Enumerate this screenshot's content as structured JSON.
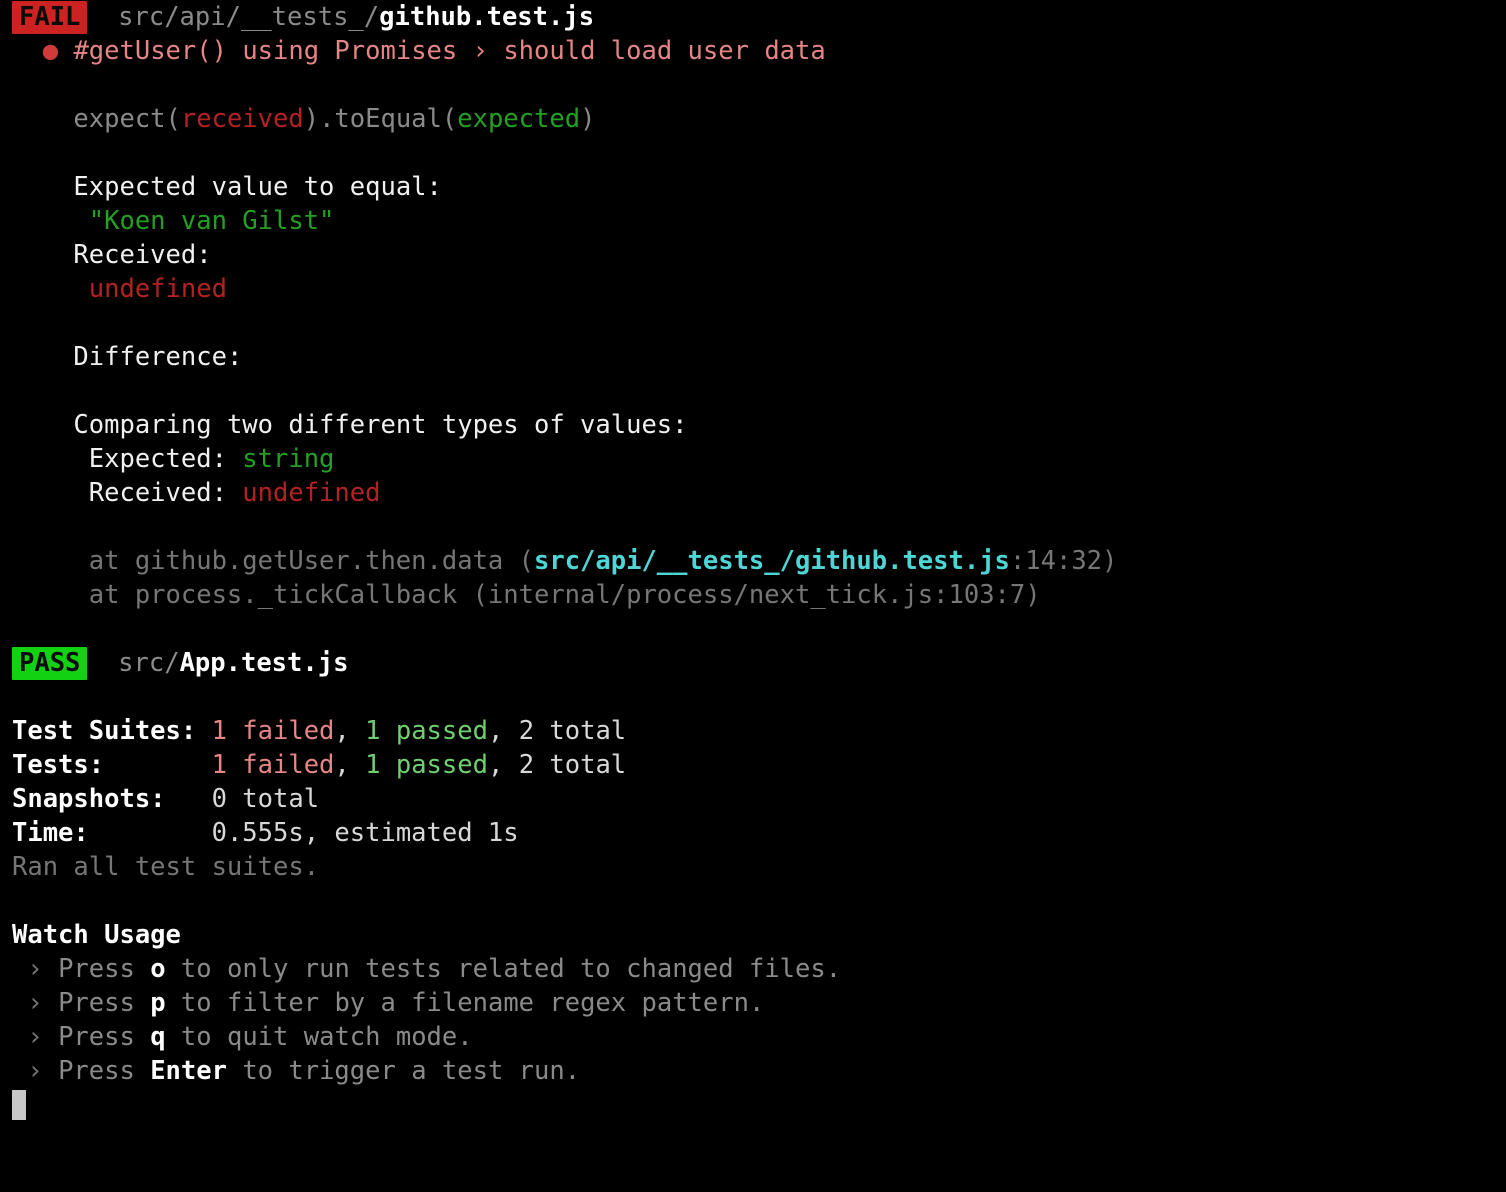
{
  "terminal": {
    "background": "#000000",
    "title": "jest --watch test runner output"
  },
  "fail_suite": {
    "badge": "FAIL",
    "badge_bg": "#cc2222",
    "path_dir": "src/api/__tests_/",
    "path_file": "github.test.js",
    "bullet": "●",
    "test_name_prefix": "#getUser() using Promises",
    "test_name_separator": "›",
    "test_name_suffix": "should load user data"
  },
  "assertion": {
    "matcher_open": "expect(",
    "matcher_received": "received",
    "matcher_middle": ").toEqual(",
    "matcher_expected": "expected",
    "matcher_close": ")",
    "expected_label": "Expected value to equal:",
    "expected_value": "\"Koen van Gilst\"",
    "received_label": "Received:",
    "received_value": "undefined",
    "difference_label": "Difference:",
    "compare_label": "Comparing two different types of values:",
    "compare_expected_label": "Expected: ",
    "compare_expected_type": "string",
    "compare_received_label": "Received: ",
    "compare_received_type": "undefined"
  },
  "stack": [
    {
      "prefix": "at github.getUser.then.data (",
      "path": "src/api/__tests_/github.test.js",
      "suffix": ":14:32)",
      "path_highlighted": true
    },
    {
      "prefix": "at process._tickCallback (internal/process/next_tick.js:103:7)",
      "path": "",
      "suffix": "",
      "path_highlighted": false
    }
  ],
  "pass_suite": {
    "badge": "PASS",
    "badge_bg": "#12d012",
    "path_dir": "src/",
    "path_file": "App.test.js"
  },
  "summary": {
    "rows": [
      {
        "label": "Test Suites:",
        "pad": " ",
        "failed": "1 failed",
        "sep1": ", ",
        "passed": "1 passed",
        "sep2": ", ",
        "total": "2 total"
      },
      {
        "label": "Tests:",
        "pad": "       ",
        "failed": "1 failed",
        "sep1": ", ",
        "passed": "1 passed",
        "sep2": ", ",
        "total": "2 total"
      }
    ],
    "snapshots_label": "Snapshots:",
    "snapshots_pad": "   ",
    "snapshots_value": "0 total",
    "time_label": "Time:",
    "time_pad": "        ",
    "time_value": "0.555s, estimated 1s",
    "ran_all": "Ran all test suites."
  },
  "watch_usage": {
    "heading": "Watch Usage",
    "items": [
      {
        "arrow": "›",
        "press": "Press ",
        "key": "o",
        "rest": " to only run tests related to changed files."
      },
      {
        "arrow": "›",
        "press": "Press ",
        "key": "p",
        "rest": " to filter by a filename regex pattern."
      },
      {
        "arrow": "›",
        "press": "Press ",
        "key": "q",
        "rest": " to quit watch mode."
      },
      {
        "arrow": "›",
        "press": "Press ",
        "key": "Enter",
        "rest": " to trigger a test run."
      }
    ]
  },
  "prompt": {
    "cursor": "block-cursor"
  }
}
